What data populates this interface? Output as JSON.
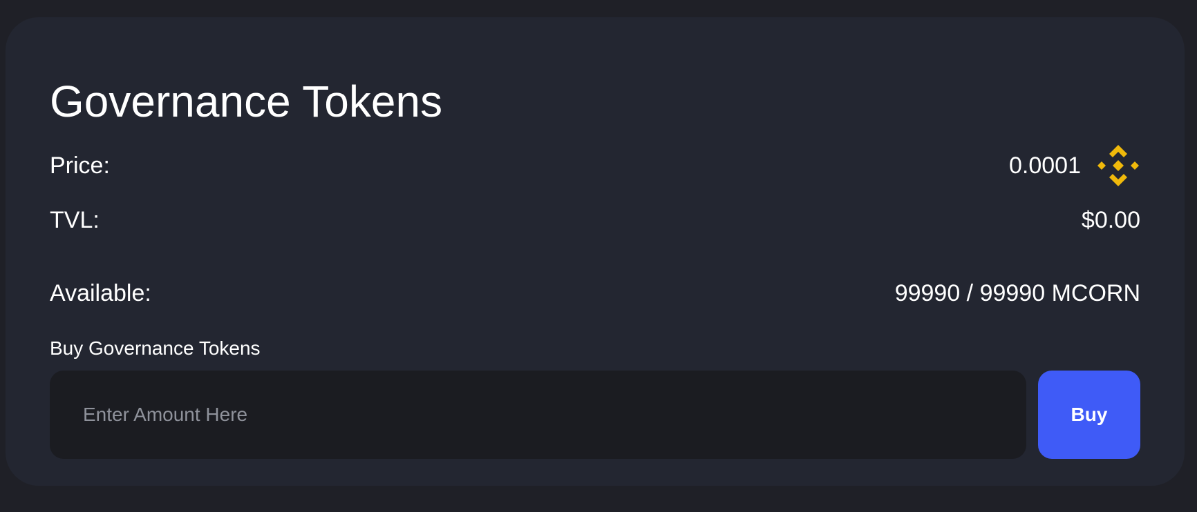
{
  "card": {
    "title": "Governance Tokens",
    "stats": {
      "price": {
        "label": "Price:",
        "value": "0.0001",
        "icon": "bnb-icon"
      },
      "tvl": {
        "label": "TVL:",
        "value": "$0.00"
      },
      "available": {
        "label": "Available:",
        "value": "99990 / 99990 MCORN"
      }
    },
    "buy": {
      "section_label": "Buy Governance Tokens",
      "input_value": "",
      "input_placeholder": "Enter Amount Here",
      "button_label": "Buy"
    }
  },
  "colors": {
    "page_background": "#1f2027",
    "card_background": "#232631",
    "input_background": "#1b1c21",
    "accent_button": "#3f5bf7",
    "bnb_icon": "#f0b90b",
    "text": "#ffffff",
    "placeholder": "#8f929b"
  }
}
